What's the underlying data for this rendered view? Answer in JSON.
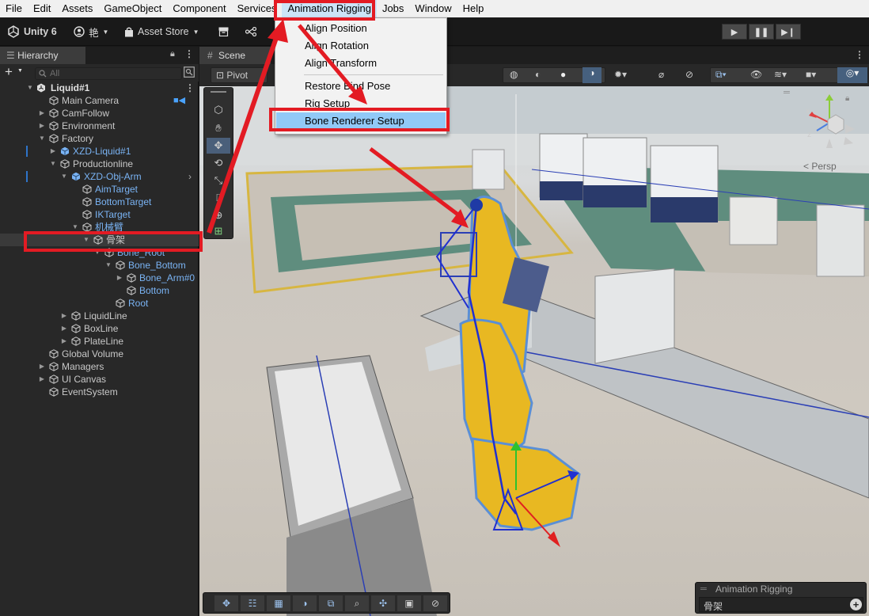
{
  "menubar": {
    "items": [
      "File",
      "Edit",
      "Assets",
      "GameObject",
      "Component",
      "Services",
      "Animation Rigging",
      "Jobs",
      "Window",
      "Help"
    ]
  },
  "toolbar": {
    "unity_label": "Unity 6",
    "account_label": "艳",
    "asset_store_label": "Asset Store"
  },
  "dropdown": {
    "items": [
      "Align Position",
      "Align Rotation",
      "Align Transform",
      "Restore Bind Pose",
      "Rig Setup",
      "Bone Renderer Setup"
    ],
    "highlighted": "Bone Renderer Setup"
  },
  "hierarchy": {
    "tab_label": "Hierarchy",
    "search_placeholder": "All",
    "rows": [
      {
        "label": "Liquid#1",
        "depth": 0
      },
      {
        "label": "Main Camera",
        "depth": 1
      },
      {
        "label": "CamFollow",
        "depth": 1
      },
      {
        "label": "Environment",
        "depth": 1
      },
      {
        "label": "Factory",
        "depth": 1
      },
      {
        "label": "XZD-Liquid#1",
        "depth": 2
      },
      {
        "label": "Productionline",
        "depth": 2
      },
      {
        "label": "XZD-Obj-Arm",
        "depth": 3
      },
      {
        "label": "AimTarget",
        "depth": 4
      },
      {
        "label": "BottomTarget",
        "depth": 4
      },
      {
        "label": "IKTarget",
        "depth": 4
      },
      {
        "label": "机械臂",
        "depth": 4
      },
      {
        "label": "骨架",
        "depth": 5
      },
      {
        "label": "Bone_Root",
        "depth": 6
      },
      {
        "label": "Bone_Bottom",
        "depth": 7
      },
      {
        "label": "Bone_Arm#0",
        "depth": 8
      },
      {
        "label": "Bottom",
        "depth": 8
      },
      {
        "label": "Root",
        "depth": 7
      },
      {
        "label": "LiquidLine",
        "depth": 3
      },
      {
        "label": "BoxLine",
        "depth": 3
      },
      {
        "label": "PlateLine",
        "depth": 3
      },
      {
        "label": "Global Volume",
        "depth": 1
      },
      {
        "label": "Managers",
        "depth": 1
      },
      {
        "label": "UI Canvas",
        "depth": 1
      },
      {
        "label": "EventSystem",
        "depth": 1
      }
    ]
  },
  "scene": {
    "tab_label": "Scene",
    "pivot_label": "Pivot",
    "persp_label": "< Persp",
    "gizmo_axes": [
      "y",
      "x",
      "z"
    ]
  },
  "overlay": {
    "title": "Animation Rigging",
    "value": "骨架"
  },
  "colors": {
    "annotation_red": "#e31b23",
    "menu_highlight": "#91c9f7",
    "prefab_blue": "#7ab4f5"
  }
}
